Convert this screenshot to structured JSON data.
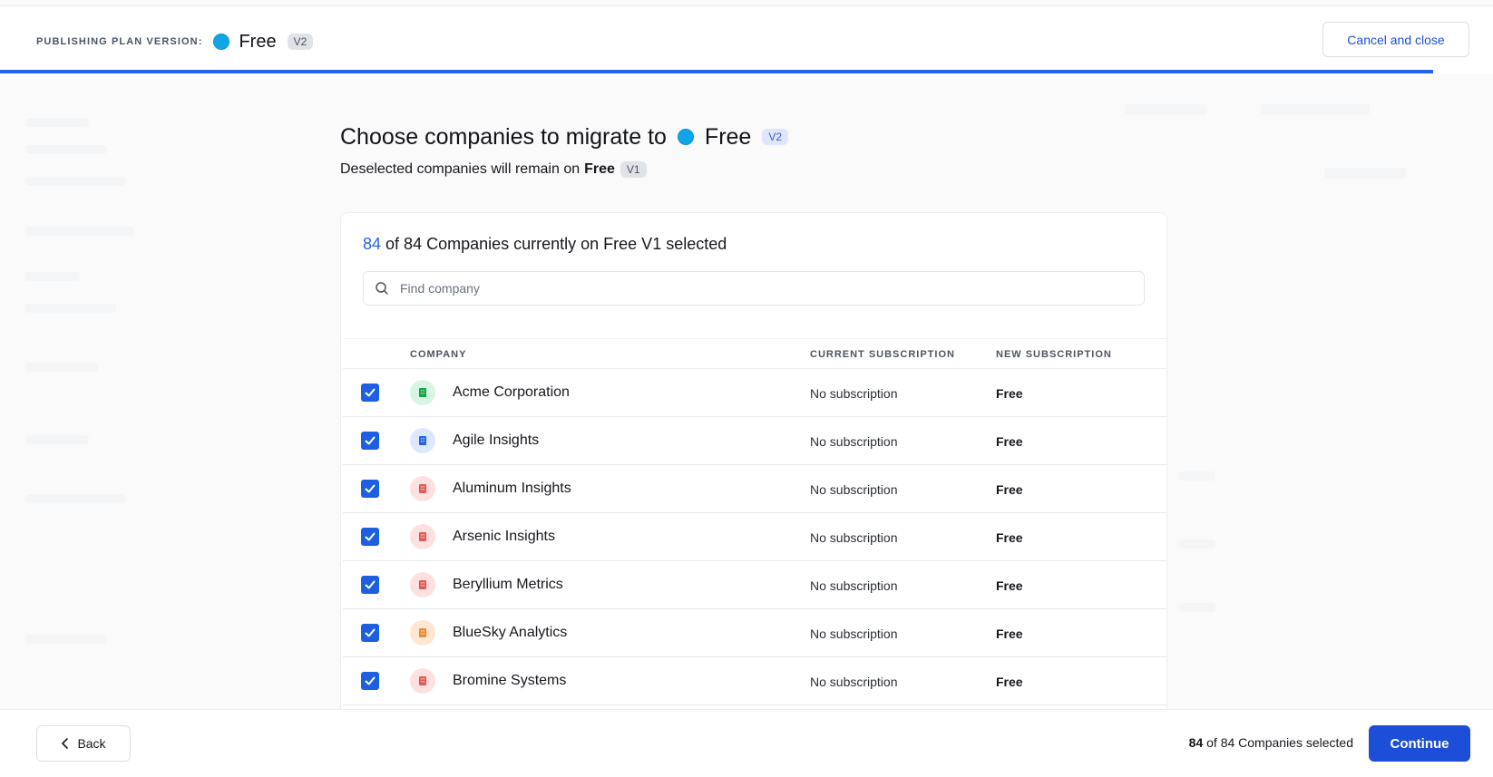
{
  "header": {
    "plan_label": "PUBLISHING PLAN VERSION:",
    "plan_name": "Free",
    "plan_version": "V2",
    "plan_color": "#0ea5e9",
    "cancel_label": "Cancel and close"
  },
  "progress": {
    "fraction": 0.96
  },
  "main": {
    "title": "Choose companies to migrate to",
    "plan_name": "Free",
    "plan_version": "V2",
    "subtitle_prefix": "Deselected companies will remain on",
    "subtitle_plan": "Free",
    "subtitle_version": "V1"
  },
  "card": {
    "selected_count": "84",
    "count_text": "of 84 Companies currently on Free V1 selected",
    "search_placeholder": "Find company",
    "columns": {
      "company": "COMPANY",
      "current": "CURRENT SUBSCRIPTION",
      "new": "NEW SUBSCRIPTION"
    },
    "rows": [
      {
        "name": "Acme Corporation",
        "current": "No subscription",
        "new": "Free",
        "checked": true,
        "avatar_bg": "#d7f5e2",
        "avatar_fg": "#16a34a"
      },
      {
        "name": "Agile Insights",
        "current": "No subscription",
        "new": "Free",
        "checked": true,
        "avatar_bg": "#dbe8fd",
        "avatar_fg": "#2563eb"
      },
      {
        "name": "Aluminum Insights",
        "current": "No subscription",
        "new": "Free",
        "checked": true,
        "avatar_bg": "#fde0e0",
        "avatar_fg": "#e05a5a"
      },
      {
        "name": "Arsenic Insights",
        "current": "No subscription",
        "new": "Free",
        "checked": true,
        "avatar_bg": "#fde0e0",
        "avatar_fg": "#e05a5a"
      },
      {
        "name": "Beryllium Metrics",
        "current": "No subscription",
        "new": "Free",
        "checked": true,
        "avatar_bg": "#fde0e0",
        "avatar_fg": "#e05a5a"
      },
      {
        "name": "BlueSky Analytics",
        "current": "No subscription",
        "new": "Free",
        "checked": true,
        "avatar_bg": "#fde6d2",
        "avatar_fg": "#ea8a3a"
      },
      {
        "name": "Bromine Systems",
        "current": "No subscription",
        "new": "Free",
        "checked": true,
        "avatar_bg": "#fde0e0",
        "avatar_fg": "#e05a5a"
      }
    ]
  },
  "footer": {
    "back_label": "Back",
    "selected_count": "84",
    "selected_text": "of 84 Companies selected",
    "continue_label": "Continue"
  }
}
